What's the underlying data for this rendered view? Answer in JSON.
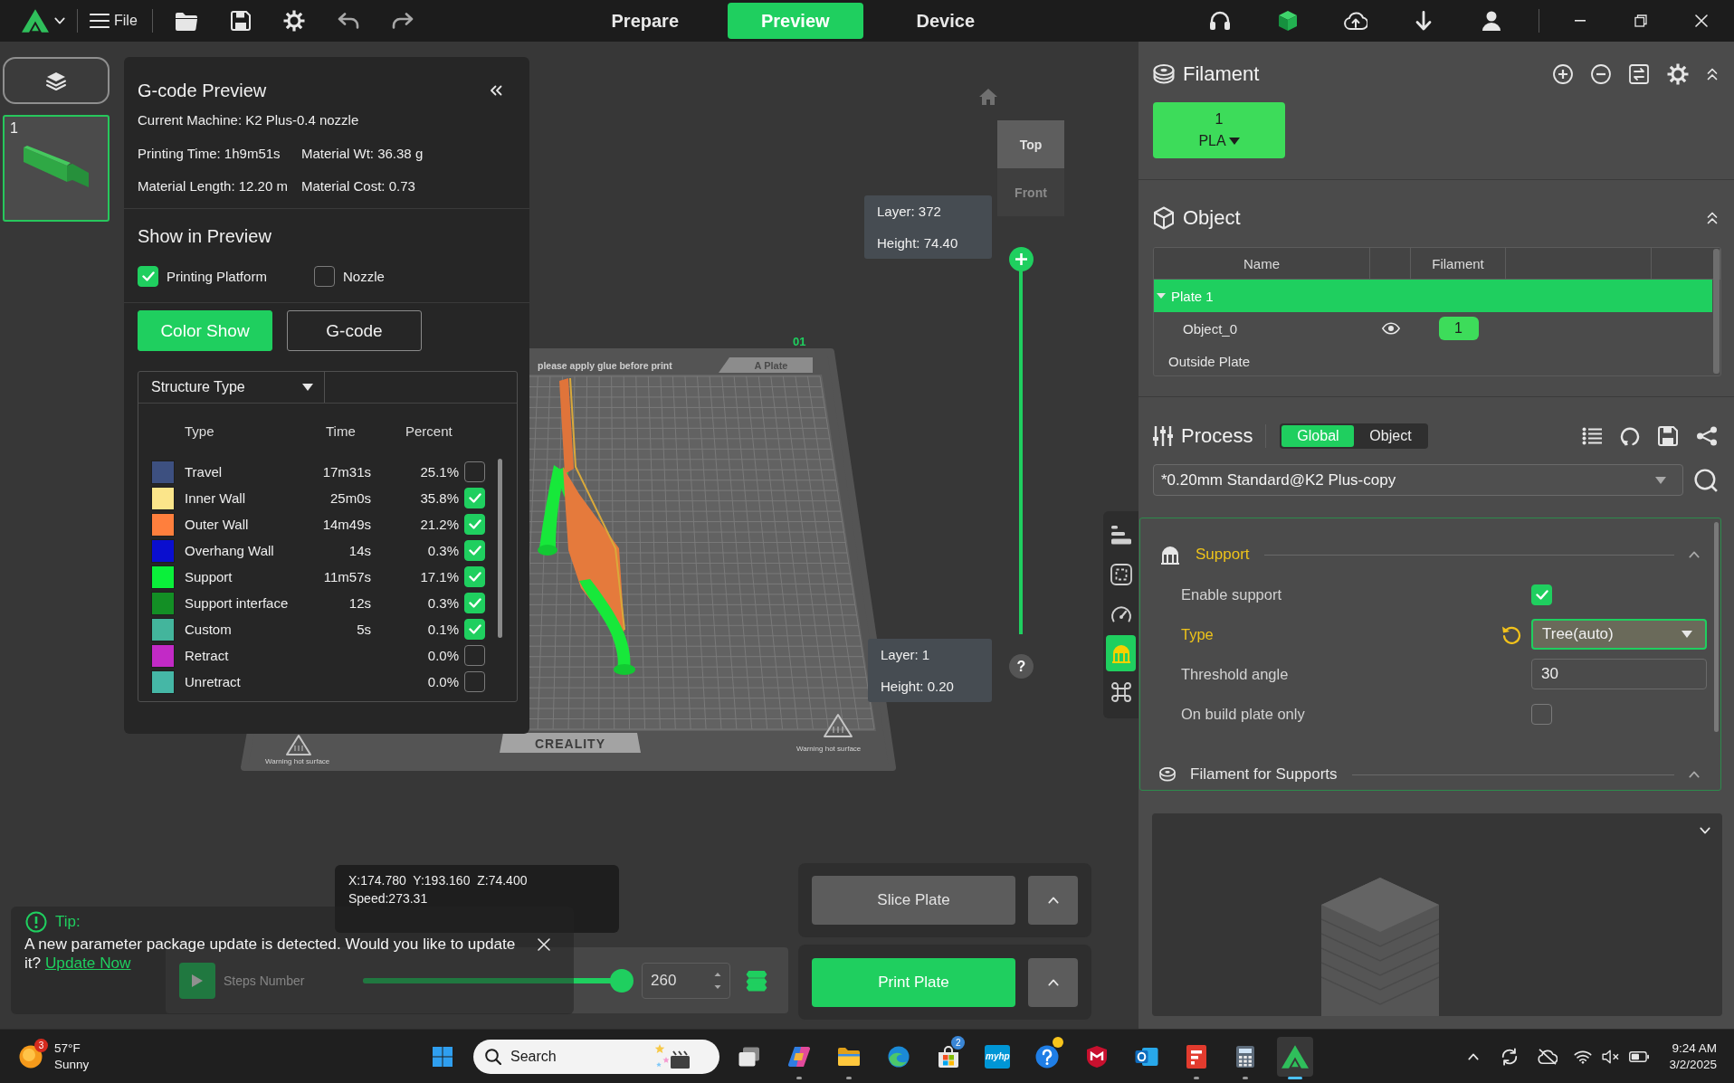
{
  "title_bar": {
    "menu": "File",
    "tabs": [
      {
        "label": "Prepare",
        "selected": false
      },
      {
        "label": "Preview",
        "selected": true
      },
      {
        "label": "Device",
        "selected": false
      }
    ]
  },
  "plates": [
    {
      "number": "1",
      "selected": true
    }
  ],
  "gcode_panel": {
    "title": "G-code Preview",
    "machine": "Current Machine: K2 Plus-0.4 nozzle",
    "stats": [
      "Printing Time: 1h9m51s",
      "Material Wt: 36.38 g",
      "Material Length: 12.20 m",
      "Material Cost: 0.73"
    ],
    "show_title": "Show in Preview",
    "show_options": [
      {
        "label": "Printing Platform",
        "checked": true
      },
      {
        "label": "Nozzle",
        "checked": false
      }
    ],
    "modes": [
      {
        "label": "Color Show",
        "selected": true
      },
      {
        "label": "G-code",
        "selected": false
      }
    ],
    "view_type": "Structure Type",
    "columns": [
      "Type",
      "Time",
      "Percent"
    ],
    "rows": [
      {
        "type": "Travel",
        "time": "17m31s",
        "percent": "25.1%",
        "color": "#3d5080",
        "checked": false
      },
      {
        "type": "Inner Wall",
        "time": "25m0s",
        "percent": "35.8%",
        "color": "#fbe58a",
        "checked": true
      },
      {
        "type": "Outer Wall",
        "time": "14m49s",
        "percent": "21.2%",
        "color": "#ff7f3d",
        "checked": true
      },
      {
        "type": "Overhang Wall",
        "time": "14s",
        "percent": "0.3%",
        "color": "#0a0ecf",
        "checked": true
      },
      {
        "type": "Support",
        "time": "11m57s",
        "percent": "17.1%",
        "color": "#0af03a",
        "checked": true
      },
      {
        "type": "Support interface",
        "time": "12s",
        "percent": "0.3%",
        "color": "#138f25",
        "checked": true
      },
      {
        "type": "Custom",
        "time": "5s",
        "percent": "0.1%",
        "color": "#43b59c",
        "checked": true
      },
      {
        "type": "Retract",
        "percent": "0.0%",
        "color": "#c22ac6",
        "checked": false
      },
      {
        "type": "Unretract",
        "percent": "0.0%",
        "color": "#45b7a6",
        "checked": false
      }
    ]
  },
  "viewport": {
    "plate": {
      "number": "01",
      "tab": "A Plate",
      "notice": "please apply glue before print",
      "brand": "CREALITY",
      "warnings": [
        "Warning hot surface",
        "Warning hot surface"
      ]
    },
    "view_buttons": [
      {
        "label": "Top",
        "selected": true
      },
      {
        "label": "Front",
        "selected": false
      }
    ],
    "layer_slider": {
      "level": 1,
      "top": {
        "layer": "Layer: 372",
        "height": "Height: 74.40"
      },
      "bottom": {
        "layer": "Layer: 1",
        "height": "Height: 0.20"
      }
    },
    "help": "?",
    "tools": [
      {
        "selected": false
      },
      {
        "selected": false
      },
      {
        "selected": false
      },
      {
        "selected": true
      },
      {
        "selected": false
      }
    ],
    "position": [
      "X:174.780  Y:193.160  Z:74.400",
      "Speed:273.31"
    ],
    "steps": {
      "label": "Steps Number",
      "level": 1,
      "value": "260"
    },
    "actions": [
      {
        "label": "Slice Plate",
        "kind": "secondary"
      },
      {
        "label": "Print Plate",
        "kind": "primary"
      }
    ],
    "tip": {
      "title": "Tip:",
      "message": "A new parameter package update is detected. Would you like to update it?",
      "link": "Update Now"
    }
  },
  "right_panel": {
    "filament": {
      "title": "Filament",
      "slots": [
        {
          "number": "1",
          "material": "PLA",
          "color": "#3ddc5a"
        }
      ]
    },
    "object": {
      "title": "Object",
      "columns": [
        "Name",
        "Filament"
      ],
      "rows": [
        {
          "kind": "plate",
          "name": "Plate 1",
          "selected": true,
          "expanded": true
        },
        {
          "kind": "object",
          "name": "Object_0",
          "visible": true,
          "filament": "1",
          "selected": false
        },
        {
          "kind": "group",
          "name": "Outside Plate",
          "selected": false
        }
      ]
    },
    "process": {
      "title": "Process",
      "scopes": [
        {
          "label": "Global",
          "selected": true
        },
        {
          "label": "Object",
          "selected": false
        }
      ],
      "preset": "*0.20mm Standard@K2 Plus-copy",
      "sections": [
        {
          "title": "Support",
          "modified": true,
          "expanded": true,
          "options": [
            {
              "kind": "checkbox",
              "label": "Enable support",
              "checked": true,
              "modified": false
            },
            {
              "kind": "select",
              "label": "Type",
              "value": "Tree(auto)",
              "modified": true,
              "focused": true
            },
            {
              "kind": "number",
              "label": "Threshold angle",
              "value": "30",
              "modified": false
            },
            {
              "kind": "checkbox",
              "label": "On build plate only",
              "checked": false,
              "modified": false
            }
          ]
        },
        {
          "title": "Filament for Supports",
          "modified": false,
          "expanded": true
        }
      ]
    }
  },
  "taskbar": {
    "weather": {
      "alerts": "3",
      "temperature": "57°F",
      "condition": "Sunny"
    },
    "search": {
      "placeholder": "Search"
    },
    "apps": [
      {
        "running": false,
        "active": false,
        "alert": false
      },
      {
        "running": true,
        "active": false,
        "alert": false
      },
      {
        "running": true,
        "active": false,
        "alert": false
      },
      {
        "running": false,
        "active": false,
        "alert": false
      },
      {
        "running": false,
        "active": false,
        "alert": false,
        "badge": "2"
      },
      {
        "running": false,
        "active": false,
        "alert": false,
        "label": "myhp"
      },
      {
        "running": false,
        "active": false,
        "alert": true
      },
      {
        "running": false,
        "active": false,
        "alert": false
      },
      {
        "running": false,
        "active": false,
        "alert": false
      },
      {
        "running": true,
        "active": false,
        "alert": false
      },
      {
        "running": true,
        "active": false,
        "alert": false
      },
      {
        "running": true,
        "active": true,
        "alert": false
      }
    ],
    "time": "9:24 AM",
    "date": "3/2/2025"
  }
}
